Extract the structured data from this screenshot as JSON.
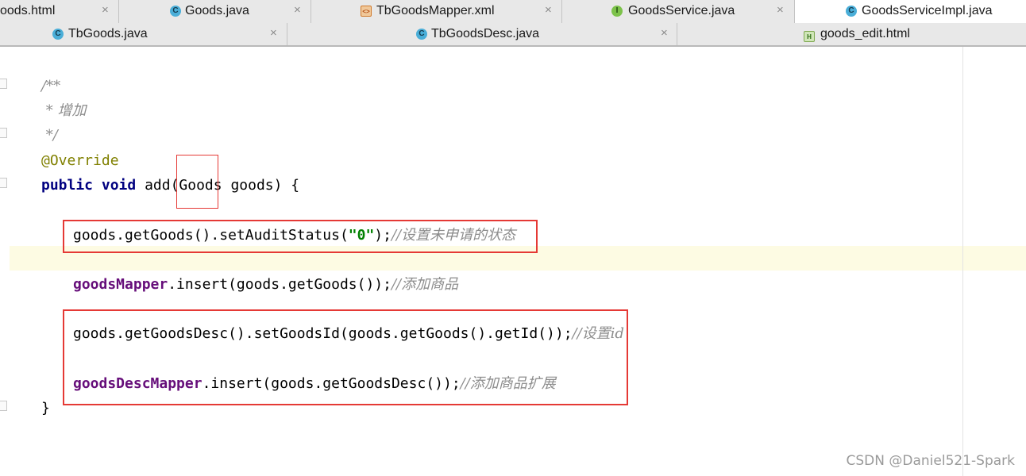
{
  "tabs_row1": [
    {
      "label": "oods.html",
      "icon": "html-file-icon",
      "active": false
    },
    {
      "label": "Goods.java",
      "icon": "class-icon",
      "active": false
    },
    {
      "label": "TbGoodsMapper.xml",
      "icon": "xml-file-icon",
      "active": false
    },
    {
      "label": "GoodsService.java",
      "icon": "interface-icon",
      "active": false
    },
    {
      "label": "GoodsServiceImpl.java",
      "icon": "class-icon",
      "active": true
    }
  ],
  "tabs_row2": [
    {
      "label": "TbGoods.java",
      "icon": "class-icon"
    },
    {
      "label": "TbGoodsDesc.java",
      "icon": "class-icon"
    },
    {
      "label": "goods_edit.html",
      "icon": "html-file-icon"
    }
  ],
  "close_glyph": "×",
  "icon_letters": {
    "class": "C",
    "interface": "I",
    "xml": "<>",
    "html": "H"
  },
  "code": {
    "doc_open": "/**",
    "doc_body": " * 增加",
    "doc_close": " */",
    "annotation": "@Override",
    "sig_kw1": "public",
    "sig_kw2": "void",
    "sig_method": " add(",
    "sig_param_type": "Goods",
    "sig_rest": " goods) {",
    "line1_code": "goods.getGoods().setAuditStatus(",
    "line1_str": "\"0\"",
    "line1_end": ");",
    "line1_comment": "//设置未申请的状态",
    "line2_field": "goodsMapper",
    "line2_code": ".insert(goods.getGoods());",
    "line2_comment": "//添加商品",
    "line3_code": "goods.getGoodsDesc().setGoodsId(goods.getGoods().getId());",
    "line3_comment": "//设置id",
    "line4_field": "goodsDescMapper",
    "line4_code": ".insert(goods.getGoodsDesc());",
    "line4_comment": "//添加商品扩展",
    "close_brace": "}"
  },
  "watermark": "CSDN @Daniel521-Spark",
  "colors": {
    "highlight_box": "#e53935",
    "keyword": "#000080",
    "field": "#660e7a",
    "string": "#008000",
    "comment": "#8c8c8c",
    "annotation": "#808000",
    "caret_line": "#fdfbe3"
  }
}
